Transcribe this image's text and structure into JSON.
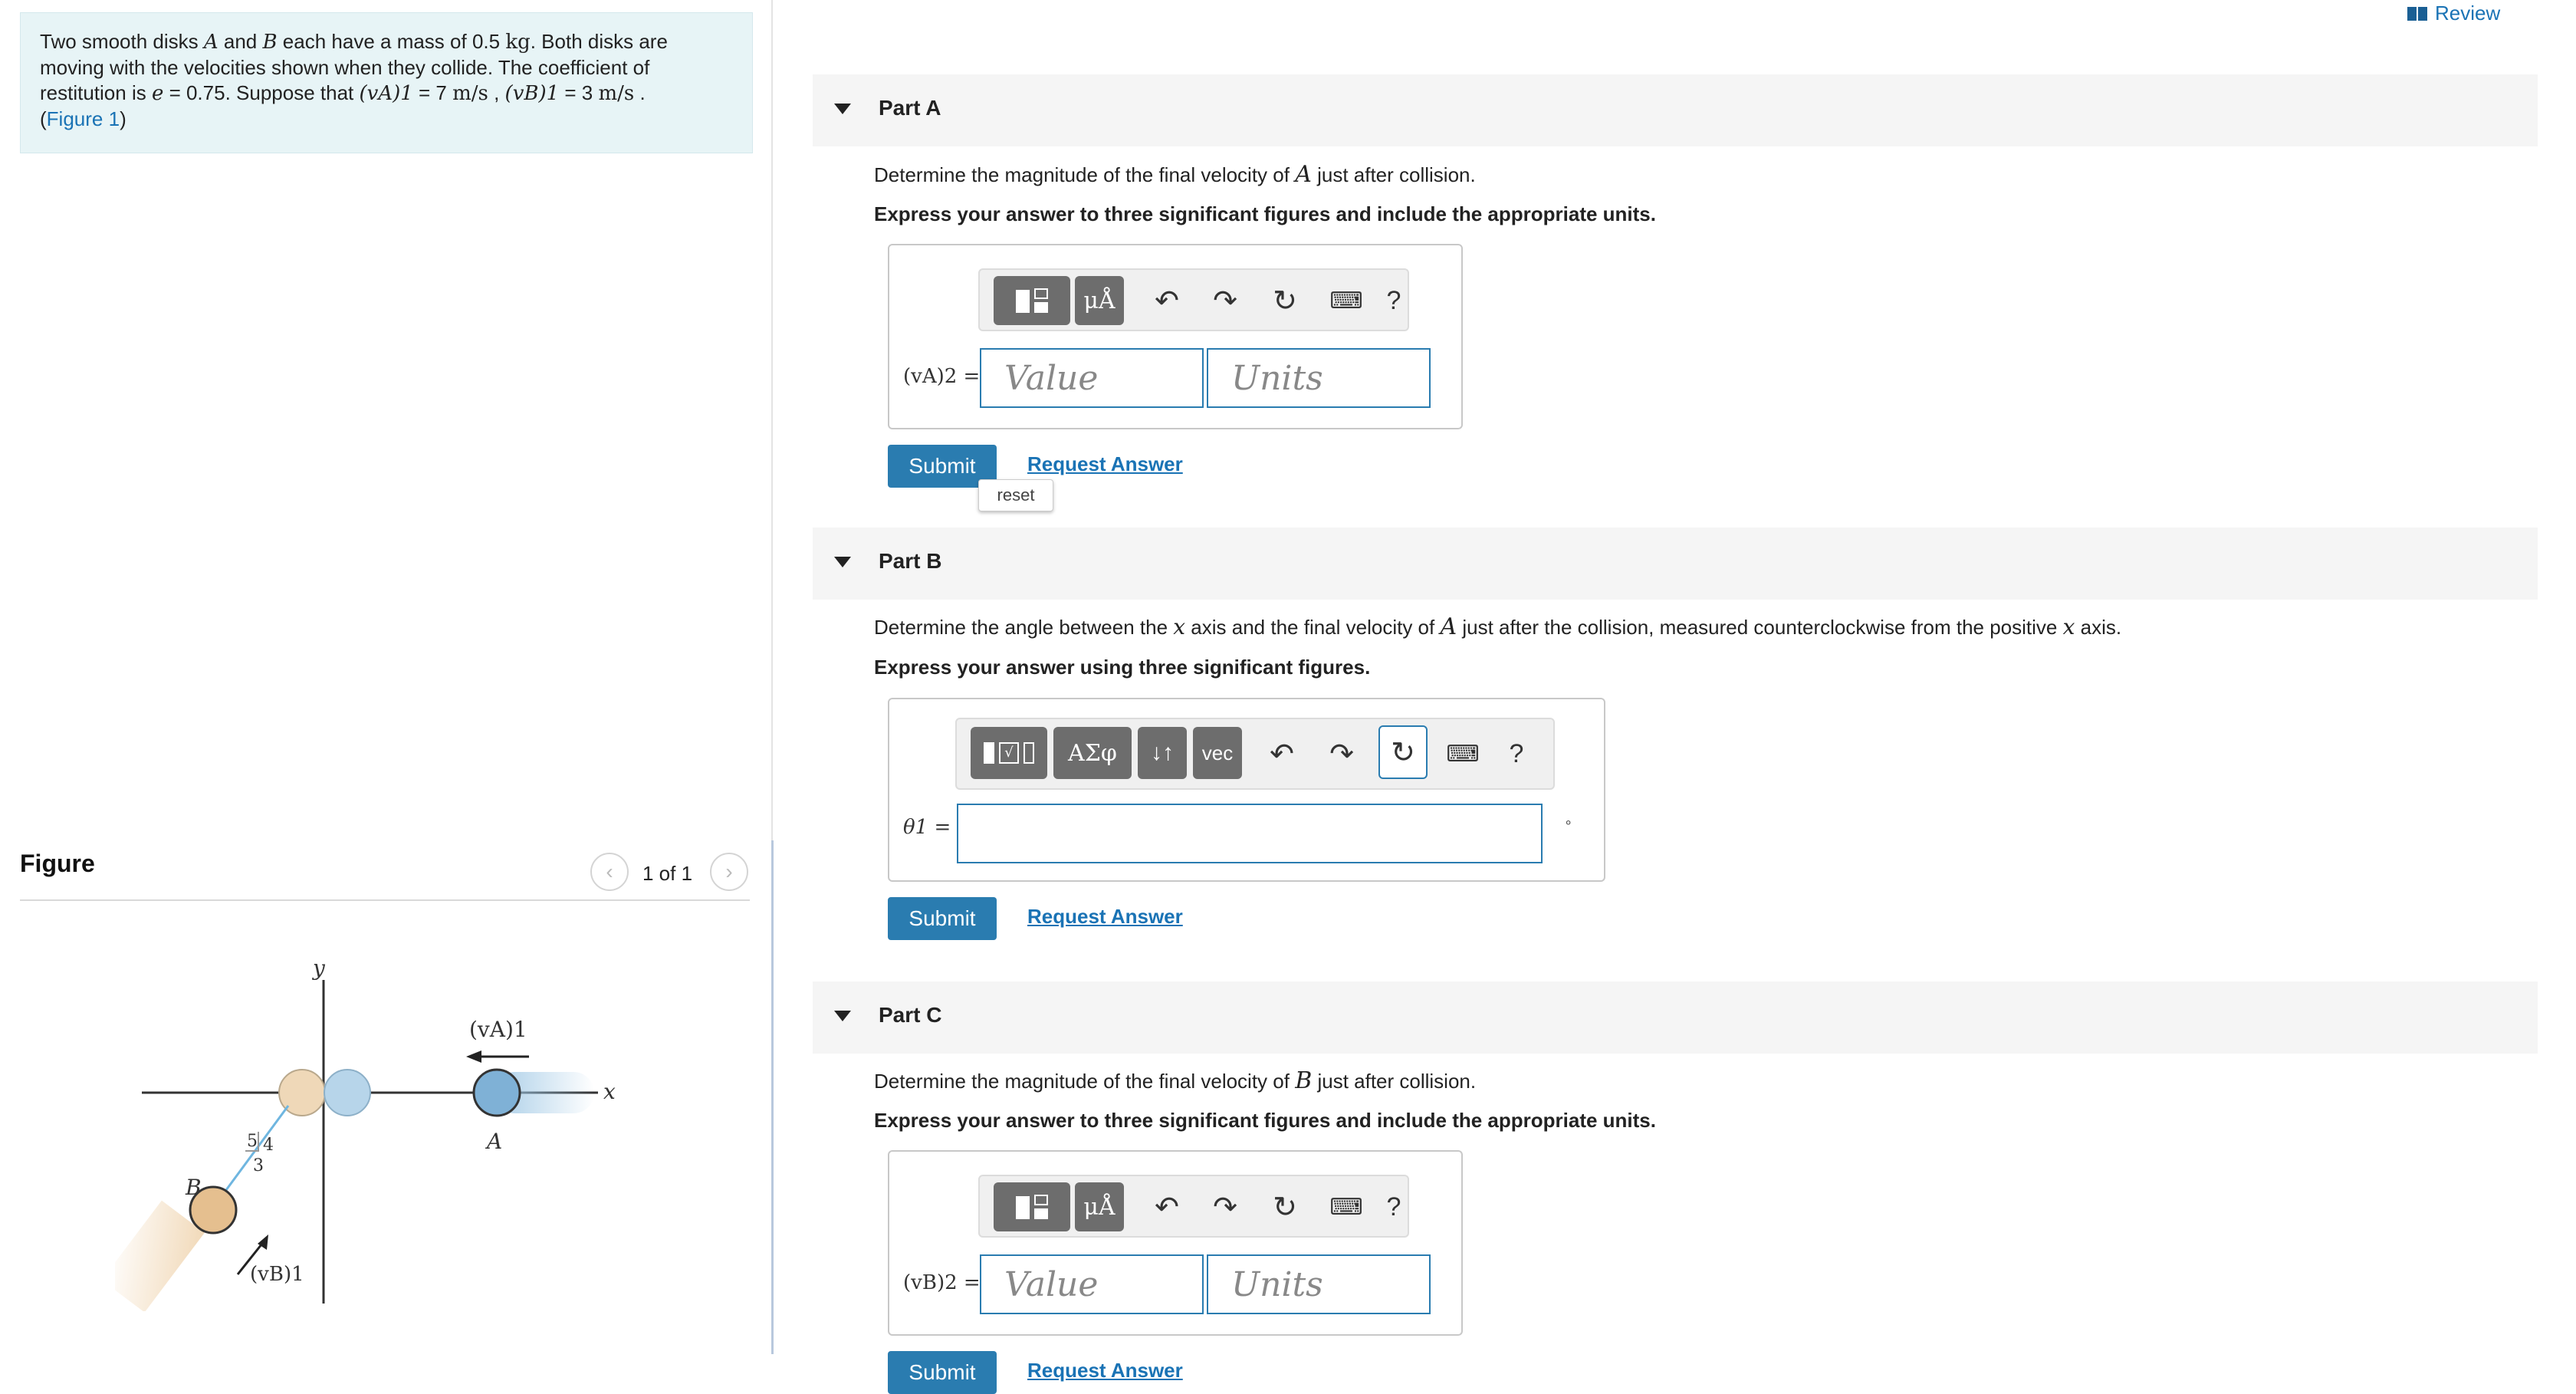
{
  "problem": {
    "t1": "Two smooth disks ",
    "A": "A",
    "t2": " and ",
    "B": "B",
    "t3": " each have a mass of 0.5 ",
    "kg": "kg",
    "t4": ". Both disks are moving with the velocities shown when they collide. The coefficient of restitution is ",
    "e": "e",
    "t5": " = 0.75. Suppose that ",
    "vA": "(vA)1",
    "t6": " = 7 ",
    "unit1": "m/s",
    "t7": " , ",
    "vB": "(vB)1",
    "t8": " = 3 ",
    "unit2": "m/s",
    "t9": " .",
    "fig_open": "(",
    "fig_link": "Figure 1",
    "fig_close": ")"
  },
  "figure": {
    "title": "Figure",
    "counter": "1 of 1",
    "labels": {
      "y": "y",
      "x": "x",
      "vA": "(vA)1",
      "vB": "(vB)1",
      "A": "A",
      "B": "B",
      "n5": "5",
      "n4": "4",
      "n3": "3"
    }
  },
  "review": "Review",
  "parts": {
    "a": {
      "title": "Part A",
      "q1": "Determine the magnitude of the final velocity of ",
      "qA": "A",
      "q2": " just after collision.",
      "instr": "Express your answer to three significant figures and include the appropriate units.",
      "var": "(vA)2 =",
      "value_ph": "Value",
      "units_ph": "Units",
      "submit": "Submit",
      "request": "Request Answer",
      "reset_tip": "reset",
      "mu": "μÅ",
      "help": "?"
    },
    "b": {
      "title": "Part B",
      "q1": "Determine the angle between the ",
      "qx1": "x",
      "q2": " axis and the final velocity of ",
      "qA": "A",
      "q3": " just after the collision, measured counterclockwise from the positive ",
      "qx2": "x",
      "q4": " axis.",
      "instr": "Express your answer using three significant figures.",
      "var": "θ1 =",
      "greek": "ΑΣφ",
      "arrows": "↓↑",
      "vec": "vec",
      "help": "?",
      "unit_dot": "∘",
      "submit": "Submit",
      "request": "Request Answer"
    },
    "c": {
      "title": "Part C",
      "q1": "Determine the magnitude of the final velocity of ",
      "qB": "B",
      "q2": " just after collision.",
      "instr": "Express your answer to three significant figures and include the appropriate units.",
      "var": "(vB)2 =",
      "value_ph": "Value",
      "units_ph": "Units",
      "mu": "μÅ",
      "help": "?",
      "submit": "Submit",
      "request": "Request Answer"
    }
  }
}
